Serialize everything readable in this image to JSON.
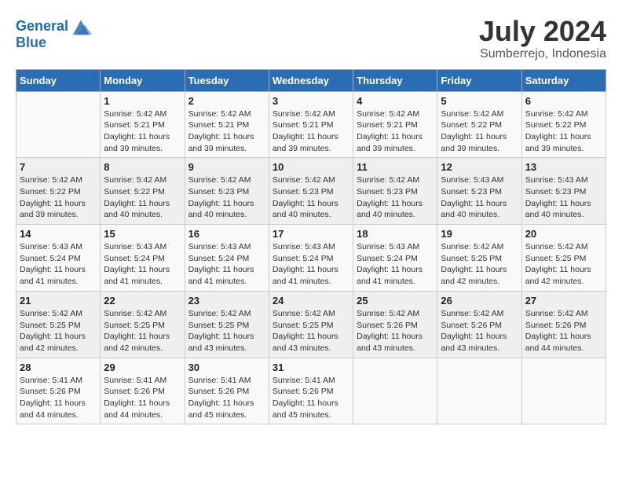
{
  "header": {
    "logo_line1": "General",
    "logo_line2": "Blue",
    "month": "July 2024",
    "location": "Sumberrejo, Indonesia"
  },
  "weekdays": [
    "Sunday",
    "Monday",
    "Tuesday",
    "Wednesday",
    "Thursday",
    "Friday",
    "Saturday"
  ],
  "weeks": [
    [
      {
        "day": null,
        "sunrise": null,
        "sunset": null,
        "daylight": null
      },
      {
        "day": "1",
        "sunrise": "Sunrise: 5:42 AM",
        "sunset": "Sunset: 5:21 PM",
        "daylight": "Daylight: 11 hours and 39 minutes."
      },
      {
        "day": "2",
        "sunrise": "Sunrise: 5:42 AM",
        "sunset": "Sunset: 5:21 PM",
        "daylight": "Daylight: 11 hours and 39 minutes."
      },
      {
        "day": "3",
        "sunrise": "Sunrise: 5:42 AM",
        "sunset": "Sunset: 5:21 PM",
        "daylight": "Daylight: 11 hours and 39 minutes."
      },
      {
        "day": "4",
        "sunrise": "Sunrise: 5:42 AM",
        "sunset": "Sunset: 5:21 PM",
        "daylight": "Daylight: 11 hours and 39 minutes."
      },
      {
        "day": "5",
        "sunrise": "Sunrise: 5:42 AM",
        "sunset": "Sunset: 5:22 PM",
        "daylight": "Daylight: 11 hours and 39 minutes."
      },
      {
        "day": "6",
        "sunrise": "Sunrise: 5:42 AM",
        "sunset": "Sunset: 5:22 PM",
        "daylight": "Daylight: 11 hours and 39 minutes."
      }
    ],
    [
      {
        "day": "7",
        "sunrise": "Sunrise: 5:42 AM",
        "sunset": "Sunset: 5:22 PM",
        "daylight": "Daylight: 11 hours and 39 minutes."
      },
      {
        "day": "8",
        "sunrise": "Sunrise: 5:42 AM",
        "sunset": "Sunset: 5:22 PM",
        "daylight": "Daylight: 11 hours and 40 minutes."
      },
      {
        "day": "9",
        "sunrise": "Sunrise: 5:42 AM",
        "sunset": "Sunset: 5:23 PM",
        "daylight": "Daylight: 11 hours and 40 minutes."
      },
      {
        "day": "10",
        "sunrise": "Sunrise: 5:42 AM",
        "sunset": "Sunset: 5:23 PM",
        "daylight": "Daylight: 11 hours and 40 minutes."
      },
      {
        "day": "11",
        "sunrise": "Sunrise: 5:42 AM",
        "sunset": "Sunset: 5:23 PM",
        "daylight": "Daylight: 11 hours and 40 minutes."
      },
      {
        "day": "12",
        "sunrise": "Sunrise: 5:43 AM",
        "sunset": "Sunset: 5:23 PM",
        "daylight": "Daylight: 11 hours and 40 minutes."
      },
      {
        "day": "13",
        "sunrise": "Sunrise: 5:43 AM",
        "sunset": "Sunset: 5:23 PM",
        "daylight": "Daylight: 11 hours and 40 minutes."
      }
    ],
    [
      {
        "day": "14",
        "sunrise": "Sunrise: 5:43 AM",
        "sunset": "Sunset: 5:24 PM",
        "daylight": "Daylight: 11 hours and 41 minutes."
      },
      {
        "day": "15",
        "sunrise": "Sunrise: 5:43 AM",
        "sunset": "Sunset: 5:24 PM",
        "daylight": "Daylight: 11 hours and 41 minutes."
      },
      {
        "day": "16",
        "sunrise": "Sunrise: 5:43 AM",
        "sunset": "Sunset: 5:24 PM",
        "daylight": "Daylight: 11 hours and 41 minutes."
      },
      {
        "day": "17",
        "sunrise": "Sunrise: 5:43 AM",
        "sunset": "Sunset: 5:24 PM",
        "daylight": "Daylight: 11 hours and 41 minutes."
      },
      {
        "day": "18",
        "sunrise": "Sunrise: 5:43 AM",
        "sunset": "Sunset: 5:24 PM",
        "daylight": "Daylight: 11 hours and 41 minutes."
      },
      {
        "day": "19",
        "sunrise": "Sunrise: 5:42 AM",
        "sunset": "Sunset: 5:25 PM",
        "daylight": "Daylight: 11 hours and 42 minutes."
      },
      {
        "day": "20",
        "sunrise": "Sunrise: 5:42 AM",
        "sunset": "Sunset: 5:25 PM",
        "daylight": "Daylight: 11 hours and 42 minutes."
      }
    ],
    [
      {
        "day": "21",
        "sunrise": "Sunrise: 5:42 AM",
        "sunset": "Sunset: 5:25 PM",
        "daylight": "Daylight: 11 hours and 42 minutes."
      },
      {
        "day": "22",
        "sunrise": "Sunrise: 5:42 AM",
        "sunset": "Sunset: 5:25 PM",
        "daylight": "Daylight: 11 hours and 42 minutes."
      },
      {
        "day": "23",
        "sunrise": "Sunrise: 5:42 AM",
        "sunset": "Sunset: 5:25 PM",
        "daylight": "Daylight: 11 hours and 43 minutes."
      },
      {
        "day": "24",
        "sunrise": "Sunrise: 5:42 AM",
        "sunset": "Sunset: 5:25 PM",
        "daylight": "Daylight: 11 hours and 43 minutes."
      },
      {
        "day": "25",
        "sunrise": "Sunrise: 5:42 AM",
        "sunset": "Sunset: 5:26 PM",
        "daylight": "Daylight: 11 hours and 43 minutes."
      },
      {
        "day": "26",
        "sunrise": "Sunrise: 5:42 AM",
        "sunset": "Sunset: 5:26 PM",
        "daylight": "Daylight: 11 hours and 43 minutes."
      },
      {
        "day": "27",
        "sunrise": "Sunrise: 5:42 AM",
        "sunset": "Sunset: 5:26 PM",
        "daylight": "Daylight: 11 hours and 44 minutes."
      }
    ],
    [
      {
        "day": "28",
        "sunrise": "Sunrise: 5:41 AM",
        "sunset": "Sunset: 5:26 PM",
        "daylight": "Daylight: 11 hours and 44 minutes."
      },
      {
        "day": "29",
        "sunrise": "Sunrise: 5:41 AM",
        "sunset": "Sunset: 5:26 PM",
        "daylight": "Daylight: 11 hours and 44 minutes."
      },
      {
        "day": "30",
        "sunrise": "Sunrise: 5:41 AM",
        "sunset": "Sunset: 5:26 PM",
        "daylight": "Daylight: 11 hours and 45 minutes."
      },
      {
        "day": "31",
        "sunrise": "Sunrise: 5:41 AM",
        "sunset": "Sunset: 5:26 PM",
        "daylight": "Daylight: 11 hours and 45 minutes."
      },
      {
        "day": null,
        "sunrise": null,
        "sunset": null,
        "daylight": null
      },
      {
        "day": null,
        "sunrise": null,
        "sunset": null,
        "daylight": null
      },
      {
        "day": null,
        "sunrise": null,
        "sunset": null,
        "daylight": null
      }
    ]
  ]
}
